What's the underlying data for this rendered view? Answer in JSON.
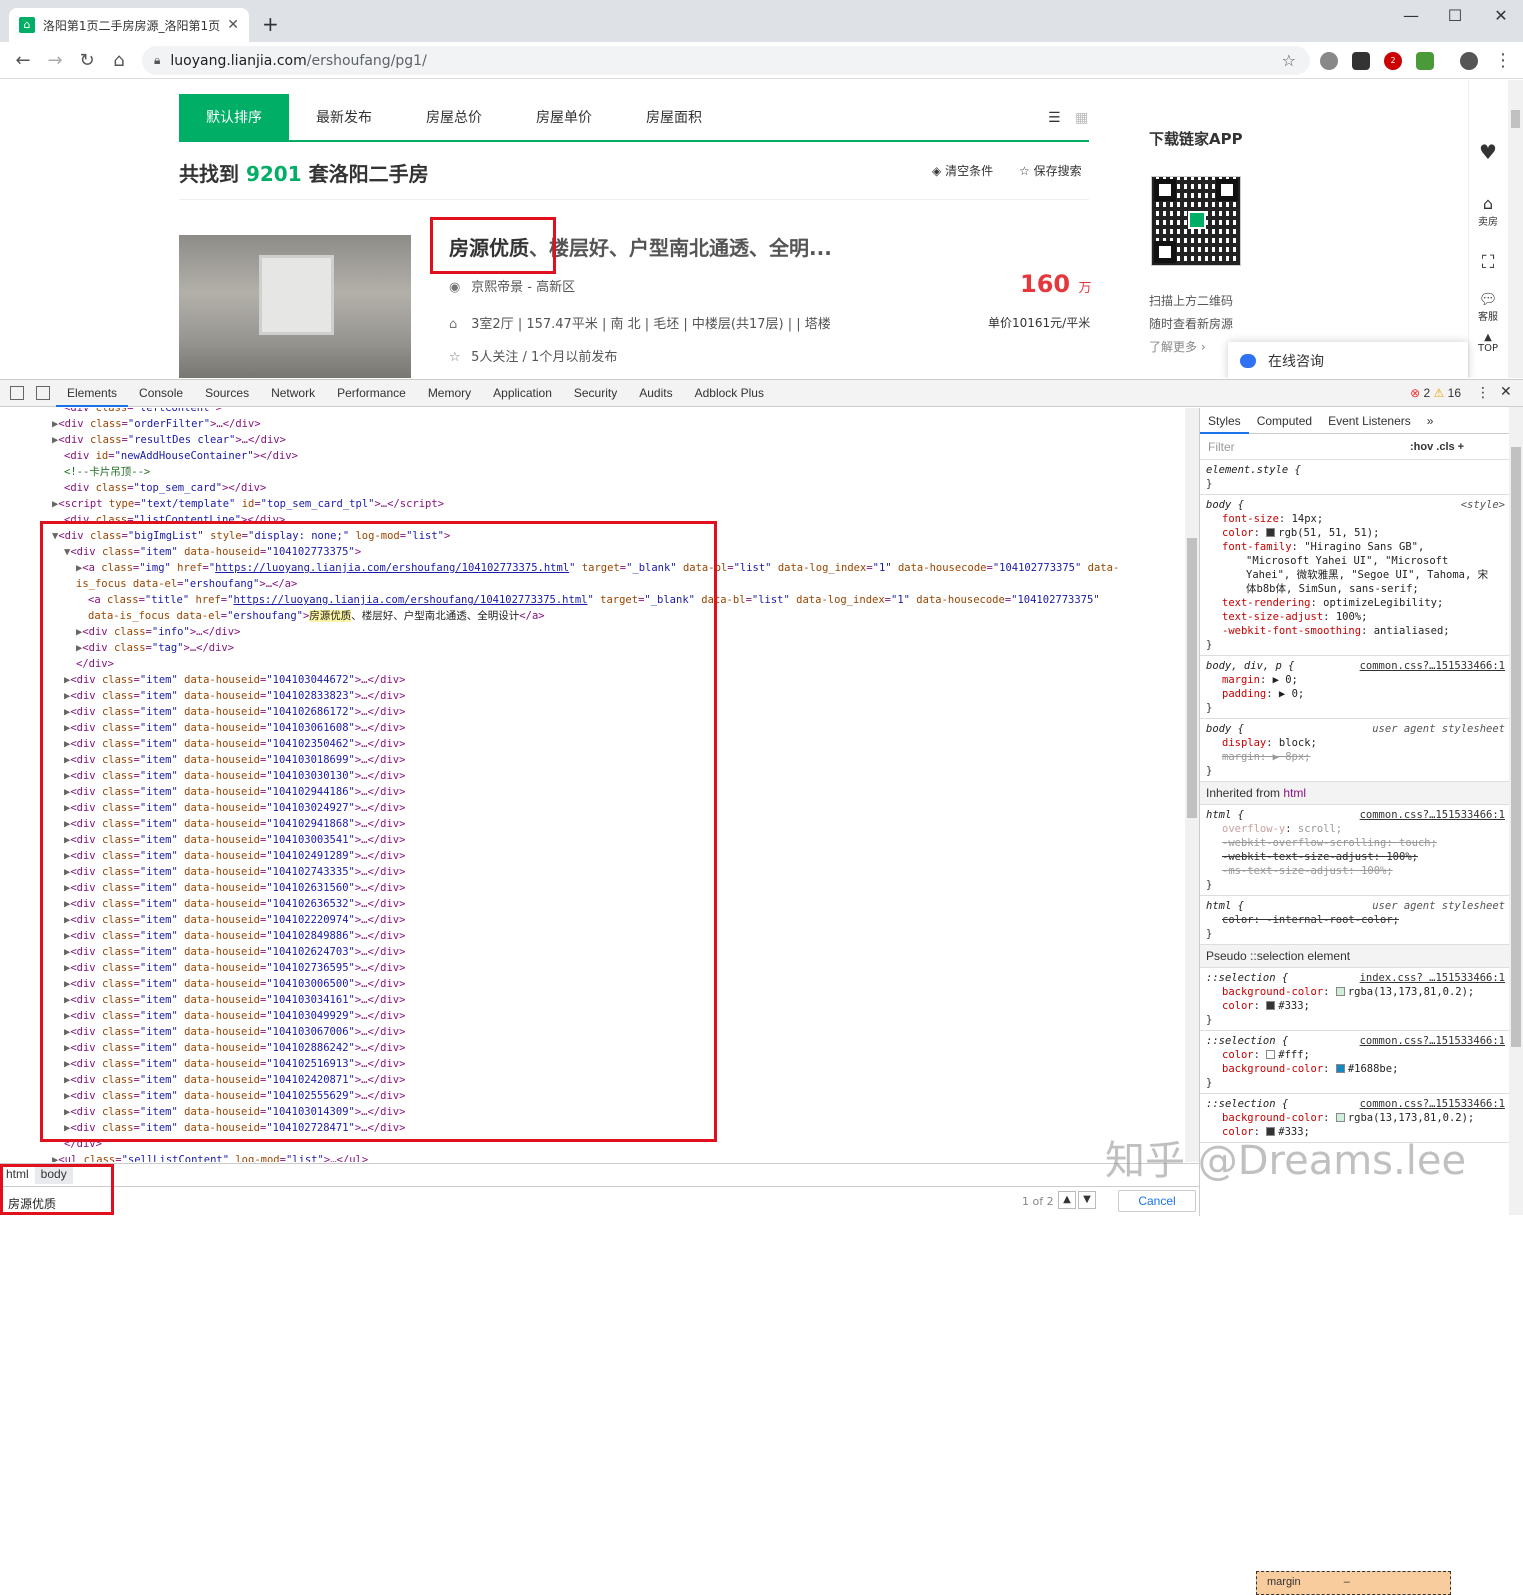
{
  "browser": {
    "tab_title": "洛阳第1页二手房房源_洛阳第1页",
    "url_domain": "luoyang.lianjia.com",
    "url_path": "/ershoufang/pg1/",
    "new_tab": "+",
    "ext_badge": "2"
  },
  "page": {
    "sort_tabs": [
      "默认排序",
      "最新发布",
      "房屋总价",
      "房屋单价",
      "房屋面积"
    ],
    "found_prefix": "共找到",
    "found_count": "9201",
    "found_suffix": "套洛阳二手房",
    "clear": "清空条件",
    "save": "保存搜索",
    "listing": {
      "title_hl": "房源优质",
      "title_rest": "、楼层好、户型南北通透、全明...",
      "location": "京熙帝景 - 高新区",
      "info": "3室2厅 | 157.47平米 | 南 北 | 毛坯 | 中楼层(共17层) | | 塔楼",
      "follow": "5人关注 / 1个月以前发布",
      "price": "160",
      "price_unit": "万",
      "unit_price": "单价10161元/平米"
    },
    "app_title": "下载链家APP",
    "qr_line1": "扫描上方二维码",
    "qr_line2": "随时查看新房源",
    "more": "了解更多 ›",
    "rail": [
      "卖房",
      "客服",
      "TOP"
    ],
    "consult": "在线咨询"
  },
  "devtools": {
    "tabs": [
      "Elements",
      "Console",
      "Sources",
      "Network",
      "Performance",
      "Memory",
      "Application",
      "Security",
      "Audits",
      "Adblock Plus"
    ],
    "errors": "2",
    "warnings": "16",
    "items_ids": [
      "104103044672",
      "104102833823",
      "104102686172",
      "104103061608",
      "104102350462",
      "104103018699",
      "104103030130",
      "104102944186",
      "104103024927",
      "104102941868",
      "104103003541",
      "104102491289",
      "104102743335",
      "104102631560",
      "104102636532",
      "104102220974",
      "104102849886",
      "104102624703",
      "104102736595",
      "104103006500",
      "104103034161",
      "104103049929",
      "104103067006",
      "104102886242",
      "104102516913",
      "104102420871",
      "104102555629",
      "104103014309",
      "104102728471"
    ],
    "breadcrumbs": [
      "html",
      "body"
    ],
    "search_query": "房源优质",
    "search_count": "1 of 2",
    "cancel": "Cancel",
    "styles_tabs": [
      "Styles",
      "Computed",
      "Event Listeners",
      "»"
    ],
    "filter_placeholder": "Filter",
    "hov": ":hov  .cls  +",
    "inherited": "Inherited from",
    "pseudo": "Pseudo ::selection element",
    "margin_label": "margin",
    "margin_val": "–"
  },
  "watermark": "知乎 @Dreams.lee"
}
